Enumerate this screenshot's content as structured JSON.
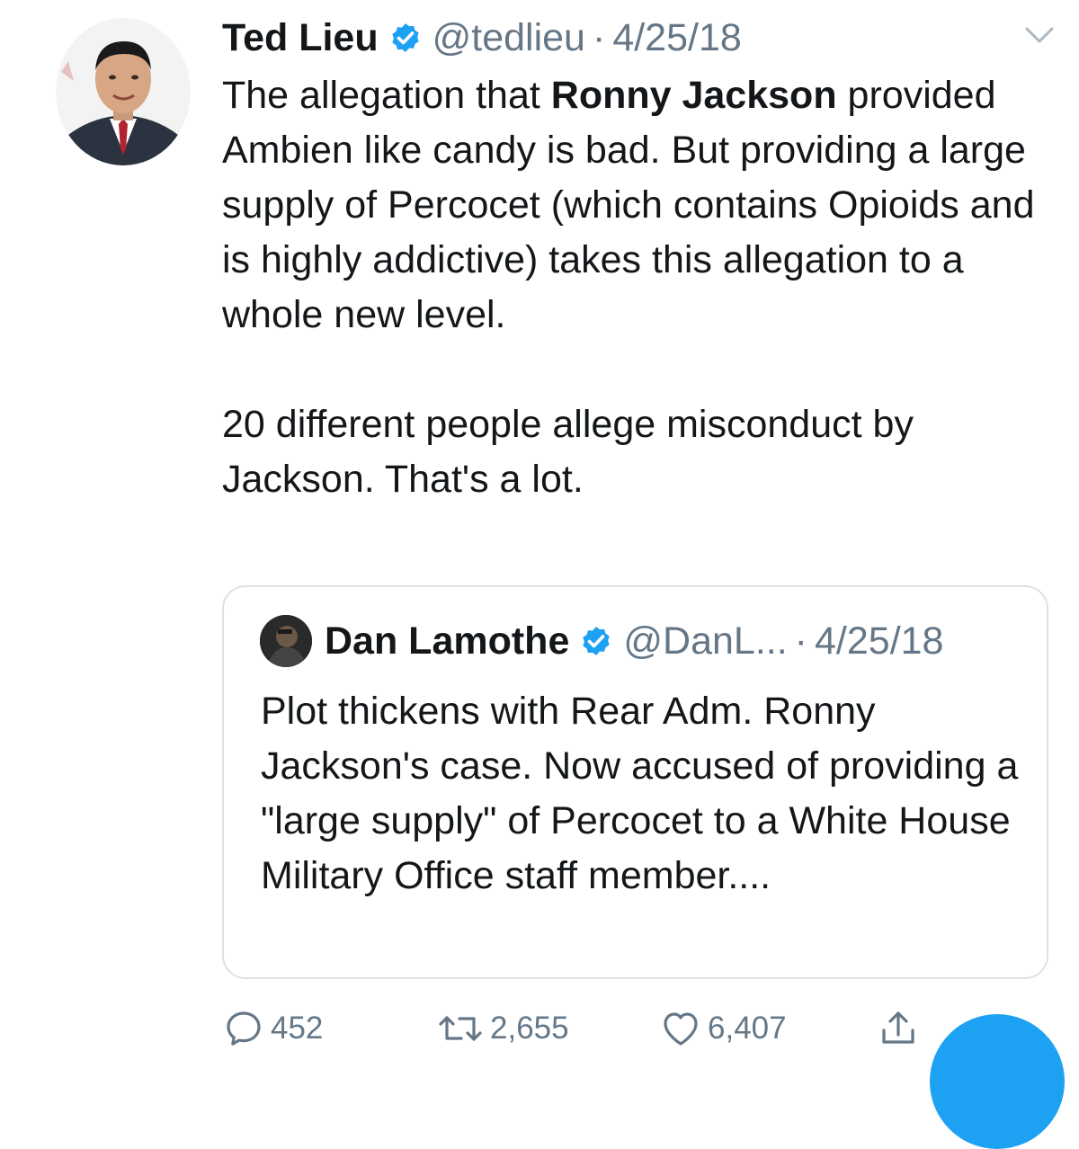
{
  "tweet": {
    "author_name": "Ted Lieu",
    "author_handle": "@tedlieu",
    "separator": "·",
    "date": "4/25/18",
    "text": {
      "line1_pre": "The allegation that ",
      "line1_bold": "Ronny Jackson",
      "line1_post": " provided Ambien like candy is bad. But providing a large supply of Percocet (which contains Opioids and is highly addictive) takes this allegation to a whole new level.",
      "paragraph2": "20 different people allege misconduct by Jackson. That's a lot."
    }
  },
  "quoted_tweet": {
    "author_name": "Dan Lamothe",
    "author_handle": "@DanL...",
    "separator": "·",
    "date": "4/25/18",
    "text": "Plot thickens with Rear Adm. Ronny Jackson's case. Now accused of providing a \"large supply\" of Percocet to a White House Military Office staff member...."
  },
  "actions": {
    "replies": "452",
    "retweets": "2,655",
    "likes": "6,407"
  },
  "icons": {
    "verified": "verified-badge-icon",
    "caret": "chevron-down-icon",
    "reply": "reply-icon",
    "retweet": "retweet-icon",
    "like": "heart-icon",
    "share": "share-icon"
  },
  "colors": {
    "accent": "#1da1f2",
    "text": "#14171a",
    "secondary": "#657786",
    "border": "#dbe2e8"
  }
}
